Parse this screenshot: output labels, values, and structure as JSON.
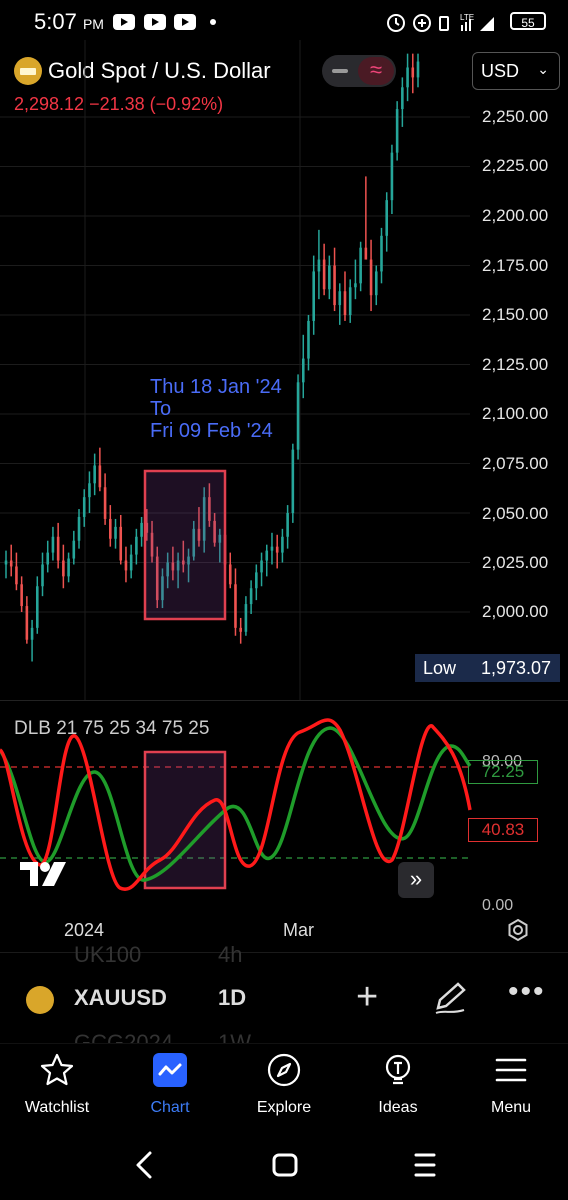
{
  "status_bar": {
    "time": "5:07",
    "ampm": "PM",
    "network": "LTE",
    "battery": "55"
  },
  "header": {
    "title": "Gold Spot / U.S. Dollar",
    "price_line": "2,298.12  −21.38 (−0.92%)",
    "currency": "USD",
    "toggle_icon": "wave-icon"
  },
  "price_axis": {
    "ticks": [
      "2,250.00",
      "2,225.00",
      "2,200.00",
      "2,175.00",
      "2,150.00",
      "2,125.00",
      "2,100.00",
      "2,075.00",
      "2,050.00",
      "2,025.00",
      "2,000.00"
    ],
    "low_label": "Low",
    "low_value": "1,973.07"
  },
  "annotation": {
    "line1": "Thu 18 Jan '24",
    "line2": "To",
    "line3": "Fri 09 Feb '24"
  },
  "indicator": {
    "label": "DLB 21 75 25 34 75 25",
    "upper_tick": "80.00",
    "lower_tick": "0.00",
    "green_value": "72.25",
    "red_value": "40.83",
    "colors": {
      "red": "#ff1a1a",
      "green": "#1f9d2a",
      "red_line": "#e03030",
      "green_line": "#2f9a40"
    }
  },
  "time_axis": {
    "labels": [
      "2024",
      "Mar"
    ]
  },
  "toolbar": {
    "ghost_top": [
      "UK100",
      "4h"
    ],
    "symbol": "XAUUSD",
    "interval": "1D",
    "ghost_bottom": [
      "GCG2024",
      "1W"
    ]
  },
  "bottom_nav": [
    {
      "label": "Watchlist",
      "icon": "star-icon"
    },
    {
      "label": "Chart",
      "icon": "chart-icon"
    },
    {
      "label": "Explore",
      "icon": "compass-icon"
    },
    {
      "label": "Ideas",
      "icon": "lightbulb-icon"
    },
    {
      "label": "Menu",
      "icon": "menu-icon"
    }
  ],
  "chart_data": {
    "type": "candlestick",
    "title": "Gold Spot / U.S. Dollar",
    "x_labels": [
      "2024",
      "Mar"
    ],
    "ylim": [
      1965,
      2280
    ],
    "up_color": "#26a69a",
    "down_color": "#ef5350",
    "highlight_range": [
      "Thu 18 Jan '24",
      "Fri 09 Feb '24"
    ],
    "candles": [
      [
        2024.0,
        2031.0,
        2017.0,
        2026.0
      ],
      [
        2026.0,
        2034.0,
        2018.0,
        2023.0
      ],
      [
        2023.0,
        2030.0,
        2011.0,
        2014.0
      ],
      [
        2014.0,
        2018.0,
        2000.0,
        2003.0
      ],
      [
        2003.0,
        2008.0,
        1984.0,
        1986.0
      ],
      [
        1986.0,
        1996.0,
        1975.0,
        1992.0
      ],
      [
        1992.0,
        2018.0,
        1989.0,
        2013.0
      ],
      [
        2013.0,
        2030.0,
        2008.0,
        2024.0
      ],
      [
        2024.0,
        2036.0,
        2020.0,
        2030.0
      ],
      [
        2030.0,
        2043.0,
        2026.0,
        2038.0
      ],
      [
        2038.0,
        2045.0,
        2022.0,
        2026.0
      ],
      [
        2026.0,
        2034.0,
        2012.0,
        2018.0
      ],
      [
        2018.0,
        2030.0,
        2015.0,
        2027.0
      ],
      [
        2027.0,
        2041.0,
        2024.0,
        2036.0
      ],
      [
        2036.0,
        2052.0,
        2032.0,
        2048.0
      ],
      [
        2048.0,
        2062.0,
        2043.0,
        2058.0
      ],
      [
        2058.0,
        2071.0,
        2050.0,
        2065.0
      ],
      [
        2065.0,
        2080.0,
        2059.0,
        2074.0
      ],
      [
        2074.0,
        2083.0,
        2061.0,
        2063.0
      ],
      [
        2063.0,
        2070.0,
        2044.0,
        2047.0
      ],
      [
        2047.0,
        2054.0,
        2033.0,
        2037.0
      ],
      [
        2037.0,
        2047.0,
        2032.0,
        2043.0
      ],
      [
        2043.0,
        2049.0,
        2024.0,
        2026.0
      ],
      [
        2026.0,
        2033.0,
        2015.0,
        2021.0
      ],
      [
        2021.0,
        2034.0,
        2017.0,
        2029.0
      ],
      [
        2029.0,
        2042.0,
        2024.0,
        2038.0
      ],
      [
        2038.0,
        2048.0,
        2033.0,
        2045.0
      ],
      [
        2045.0,
        2052.0,
        2036.0,
        2040.0
      ],
      [
        2040.0,
        2046.0,
        2025.0,
        2028.0
      ],
      [
        2028.0,
        2033.0,
        2002.0,
        2006.0
      ],
      [
        2006.0,
        2022.0,
        2002.0,
        2018.0
      ],
      [
        2018.0,
        2030.0,
        2012.0,
        2025.0
      ],
      [
        2025.0,
        2033.0,
        2016.0,
        2021.0
      ],
      [
        2021.0,
        2030.0,
        2012.0,
        2026.0
      ],
      [
        2026.0,
        2036.0,
        2020.0,
        2024.0
      ],
      [
        2024.0,
        2032.0,
        2015.0,
        2028.0
      ],
      [
        2028.0,
        2046.0,
        2026.0,
        2042.0
      ],
      [
        2042.0,
        2053.0,
        2033.0,
        2036.0
      ],
      [
        2036.0,
        2063.0,
        2030.0,
        2058.0
      ],
      [
        2058.0,
        2065.0,
        2043.0,
        2046.0
      ],
      [
        2046.0,
        2050.0,
        2033.0,
        2035.0
      ],
      [
        2035.0,
        2042.0,
        2025.0,
        2039.0
      ],
      [
        2039.0,
        2045.0,
        2022.0,
        2024.0
      ],
      [
        2024.0,
        2030.0,
        2012.0,
        2014.0
      ],
      [
        2014.0,
        2022.0,
        1988.0,
        1992.0
      ],
      [
        1992.0,
        1997.0,
        1984.0,
        1990.0
      ],
      [
        1990.0,
        2008.0,
        1988.0,
        2004.0
      ],
      [
        2004.0,
        2016.0,
        1999.0,
        2012.0
      ],
      [
        2012.0,
        2024.0,
        2006.0,
        2020.0
      ],
      [
        2020.0,
        2030.0,
        2013.0,
        2026.0
      ],
      [
        2026.0,
        2034.0,
        2018.0,
        2031.0
      ],
      [
        2031.0,
        2040.0,
        2024.0,
        2033.0
      ],
      [
        2033.0,
        2039.0,
        2022.0,
        2030.0
      ],
      [
        2030.0,
        2042.0,
        2025.0,
        2038.0
      ],
      [
        2038.0,
        2054.0,
        2032.0,
        2050.0
      ],
      [
        2050.0,
        2085.0,
        2045.0,
        2082.0
      ],
      [
        2082.0,
        2120.0,
        2077.0,
        2116.0
      ],
      [
        2116.0,
        2140.0,
        2108.0,
        2128.0
      ],
      [
        2128.0,
        2150.0,
        2122.0,
        2147.0
      ],
      [
        2147.0,
        2180.0,
        2140.0,
        2172.0
      ],
      [
        2172.0,
        2193.0,
        2158.0,
        2178.0
      ],
      [
        2178.0,
        2186.0,
        2160.0,
        2163.0
      ],
      [
        2163.0,
        2180.0,
        2158.0,
        2175.0
      ],
      [
        2175.0,
        2184.0,
        2152.0,
        2155.0
      ],
      [
        2155.0,
        2166.0,
        2145.0,
        2162.0
      ],
      [
        2162.0,
        2172.0,
        2147.0,
        2150.0
      ],
      [
        2150.0,
        2168.0,
        2146.0,
        2164.0
      ],
      [
        2164.0,
        2178.0,
        2158.0,
        2166.0
      ],
      [
        2166.0,
        2187.0,
        2162.0,
        2184.0
      ],
      [
        2184.0,
        2220.0,
        2180.0,
        2178.0
      ],
      [
        2178.0,
        2188.0,
        2152.0,
        2160.0
      ],
      [
        2160.0,
        2175.0,
        2155.0,
        2172.0
      ],
      [
        2172.0,
        2194.0,
        2166.0,
        2190.0
      ],
      [
        2190.0,
        2212.0,
        2182.0,
        2208.0
      ],
      [
        2208.0,
        2236.0,
        2201.0,
        2232.0
      ],
      [
        2232.0,
        2258.0,
        2228.0,
        2254.0
      ],
      [
        2254.0,
        2270.0,
        2245.0,
        2265.0
      ],
      [
        2265.0,
        2282.0,
        2258.0,
        2275.0
      ],
      [
        2275.0,
        2282.0,
        2262.0,
        2270.0
      ],
      [
        2270.0,
        2282.0,
        2265.0,
        2278.0
      ]
    ]
  }
}
